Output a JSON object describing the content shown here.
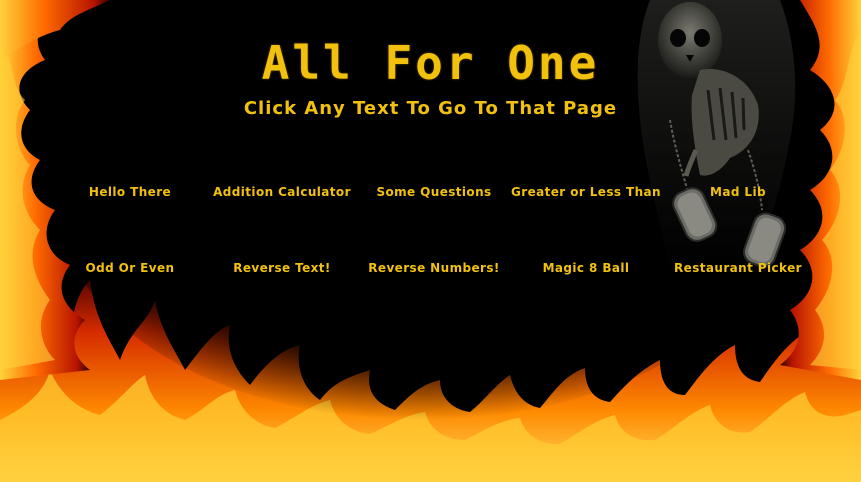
{
  "header": {
    "title": "All For One",
    "subtitle": "Click Any Text To Go To That Page"
  },
  "links": {
    "row1": [
      {
        "label": "Hello There"
      },
      {
        "label": "Addition Calculator"
      },
      {
        "label": "Some Questions"
      },
      {
        "label": "Greater or Less Than"
      },
      {
        "label": "Mad Lib"
      }
    ],
    "row2": [
      {
        "label": "Odd Or Even"
      },
      {
        "label": "Reverse Text!"
      },
      {
        "label": "Reverse Numbers!"
      },
      {
        "label": "Magic 8 Ball"
      },
      {
        "label": "Restaurant Picker"
      }
    ]
  },
  "colors": {
    "text": "#f2c10d",
    "background": "#000000",
    "flame_outer": "#b81400",
    "flame_mid": "#ff6a00",
    "flame_inner": "#ffd23a"
  },
  "decor": {
    "background": "flames-image",
    "figure": "grim-reaper-image"
  }
}
